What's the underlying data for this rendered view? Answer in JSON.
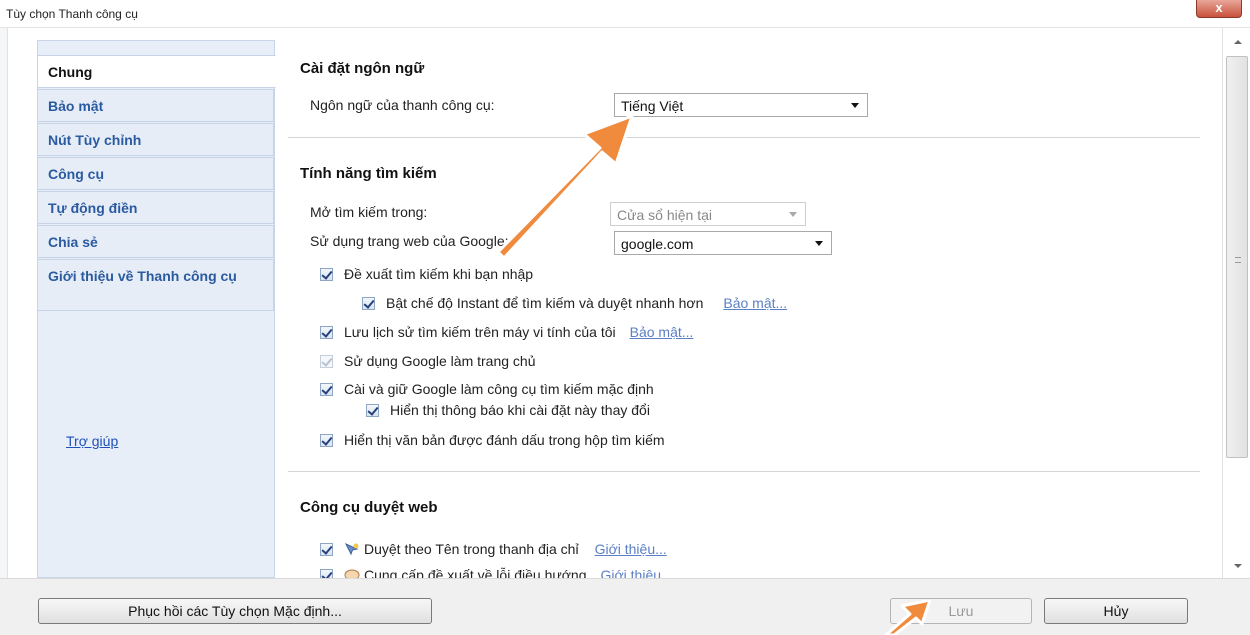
{
  "window": {
    "title": "Tùy chọn Thanh công cụ",
    "close_label": "x"
  },
  "sidebar": {
    "items": [
      {
        "label": "Chung",
        "active": true
      },
      {
        "label": "Bảo mật",
        "active": false
      },
      {
        "label": "Nút Tùy chỉnh",
        "active": false
      },
      {
        "label": "Công cụ",
        "active": false
      },
      {
        "label": "Tự động điền",
        "active": false
      },
      {
        "label": "Chia sẻ",
        "active": false
      },
      {
        "label": "Giới thiệu về Thanh công cụ",
        "active": false
      }
    ],
    "help_link": "Trợ giúp"
  },
  "language": {
    "title": "Cài đặt ngôn ngữ",
    "toolbar_language_label": "Ngôn ngữ của thanh công cụ:",
    "toolbar_language_value": "Tiếng Việt"
  },
  "search": {
    "title": "Tính năng tìm kiếm",
    "open_in_label": "Mở tìm kiếm trong:",
    "open_in_value": "Cửa sổ hiện tại",
    "google_site_label": "Sử dụng trang web của Google:",
    "google_site_value": "google.com",
    "suggest_label": "Đề xuất tìm kiếm khi bạn nhập",
    "instant_label": "Bật chế độ Instant để tìm kiếm và duyệt nhanh hơn",
    "instant_link": "Bảo mật...",
    "history_label": "Lưu lịch sử tìm kiếm trên máy vi tính của tôi",
    "history_link": "Bảo mật...",
    "homepage_label": "Sử dụng Google làm trang chủ",
    "default_engine_label": "Cài và giữ Google làm công cụ tìm kiếm mặc định",
    "notify_label": "Hiển thị thông báo khi cài đặt này thay đổi",
    "highlight_label": "Hiển thị văn bản được đánh dấu trong hộp tìm kiếm"
  },
  "browsing": {
    "title": "Công cụ duyệt web",
    "browse_by_name_label": "Duyệt theo Tên trong thanh địa chỉ",
    "browse_by_name_link": "Giới thiệu...",
    "nav_error_label": "Cung cấp đề xuất về lỗi điều hướng",
    "nav_error_link": "Giới thiệu..."
  },
  "footer": {
    "restore_label": "Phục hồi các Tùy chọn Mặc định...",
    "save_label": "Lưu",
    "cancel_label": "Hủy"
  },
  "colors": {
    "accent_link": "#2a5aa0",
    "arrow": "#f08a3c",
    "close": "#c9523c"
  },
  "icons": [
    "close-icon",
    "dropdown-caret-icon",
    "checkbox-icon",
    "browse-icon",
    "nav-error-icon",
    "scroll-up-icon",
    "scroll-down-icon",
    "annotation-arrow-icon"
  ]
}
